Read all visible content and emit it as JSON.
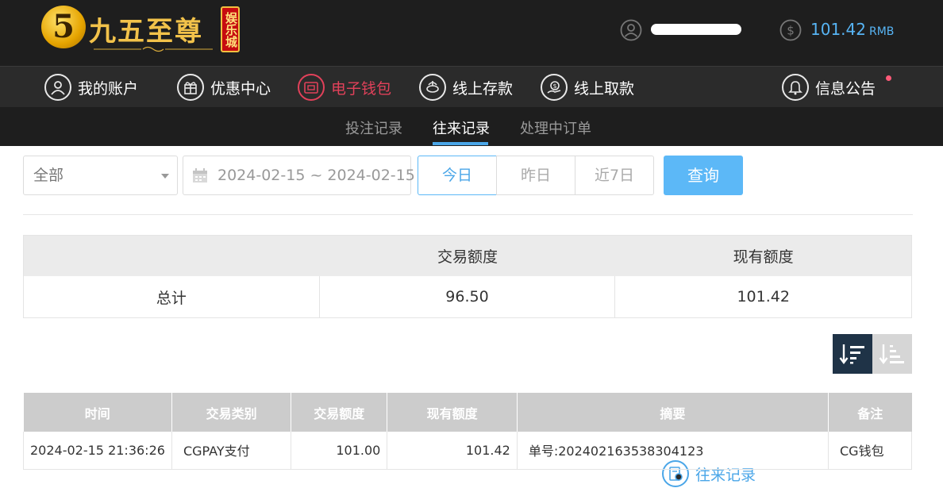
{
  "header": {
    "logo_text": "九五至尊",
    "logo_badge": "娱乐城",
    "logo_mark": "5",
    "balance_value": "101.42",
    "balance_unit": "RMB"
  },
  "nav": {
    "items": [
      {
        "label": "我的账户",
        "icon": "user-icon"
      },
      {
        "label": "优惠中心",
        "icon": "gift-icon"
      },
      {
        "label": "电子钱包",
        "icon": "wallet-icon"
      },
      {
        "label": "线上存款",
        "icon": "deposit-icon"
      },
      {
        "label": "线上取款",
        "icon": "withdraw-icon"
      },
      {
        "label": "往来记录",
        "icon": "records-icon"
      },
      {
        "label": "信息公告",
        "icon": "bell-icon"
      }
    ],
    "active": "往来记录",
    "accent_wallet": "#e2415a",
    "accent_active": "#4aa6e8"
  },
  "subnav": {
    "tabs": [
      "投注记录",
      "往来记录",
      "处理中订单"
    ],
    "active": "往来记录"
  },
  "filters": {
    "type_select": "全部",
    "date_range": "2024-02-15 ~ 2024-02-15",
    "quick": [
      "今日",
      "昨日",
      "近7日"
    ],
    "quick_active": "今日",
    "query_button": "查询"
  },
  "summary": {
    "headers": [
      "",
      "交易额度",
      "现有额度"
    ],
    "row": {
      "label": "总计",
      "amount": "96.50",
      "balance": "101.42"
    }
  },
  "records": {
    "headers": [
      "时间",
      "交易类别",
      "交易额度",
      "现有额度",
      "摘要",
      "备注"
    ],
    "rows": [
      {
        "time": "2024-02-15 21:36:26",
        "type": "CGPAY支付",
        "amount": "101.00",
        "balance": "101.42",
        "summary": "单号:202402163538304123",
        "note": "CG钱包"
      }
    ]
  }
}
